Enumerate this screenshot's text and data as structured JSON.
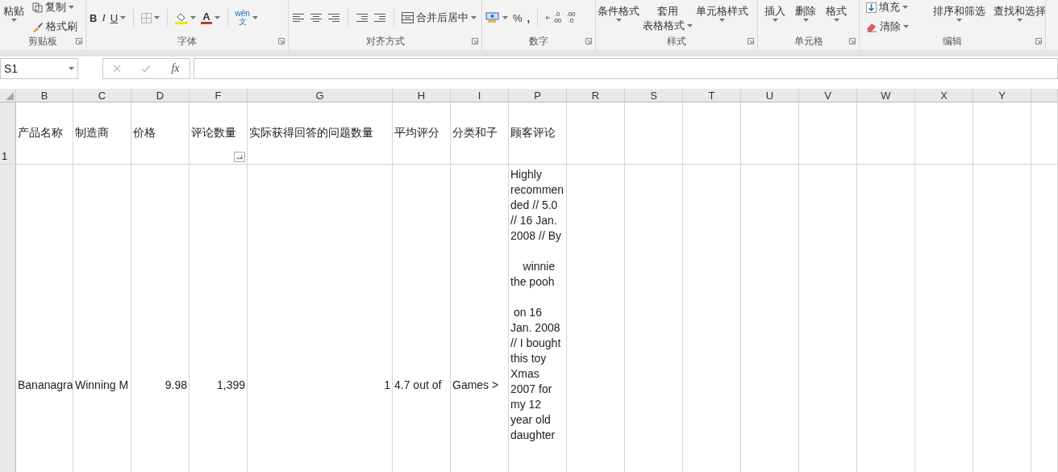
{
  "ribbon": {
    "clipboard": {
      "label": "剪贴板",
      "paste": "粘贴",
      "copy": "复制",
      "format_painter": "格式刷"
    },
    "font": {
      "label": "字体",
      "bold": "B",
      "italic": "I",
      "underline": "U",
      "font_color": "A",
      "phonetic_top": "wén",
      "phonetic_bottom": "文"
    },
    "alignment": {
      "label": "对齐方式",
      "merge": "合并后居中"
    },
    "number": {
      "label": "数字",
      "percent": "%",
      "comma": ",",
      "increase_decimal": {
        "top": ".0",
        "bottom": ".00"
      },
      "decrease_decimal": {
        "top": ".00",
        "bottom": ".0"
      }
    },
    "styles": {
      "label": "样式",
      "conditional": "条件格式",
      "table_format_top": "套用",
      "table_format_bottom": "表格格式",
      "cell_styles": "单元格样式"
    },
    "cells": {
      "label": "单元格",
      "insert": "插入",
      "delete": "删除",
      "format": "格式"
    },
    "editing": {
      "label": "编辑",
      "fill": "填充",
      "clear": "清除",
      "sort": "排序和筛选",
      "find": "查找和选择"
    }
  },
  "formula_bar": {
    "name_box": "S1",
    "fx": "fx"
  },
  "sheet": {
    "columns": [
      "B",
      "C",
      "D",
      "F",
      "G",
      "H",
      "I",
      "P",
      "R",
      "S",
      "T",
      "U",
      "V",
      "W",
      "X",
      "Y"
    ],
    "rows": [
      {
        "number": "1",
        "cells": [
          {
            "text": "产品名称",
            "kind": "text",
            "options_button": false
          },
          {
            "text": "制造商",
            "kind": "text",
            "options_button": false
          },
          {
            "text": "价格",
            "kind": "text",
            "options_button": false
          },
          {
            "text": "评论数量",
            "kind": "text",
            "options_button": true
          },
          {
            "text": "实际获得回答的问题数量",
            "kind": "text",
            "options_button": false
          },
          {
            "text": "平均评分",
            "kind": "text",
            "options_button": false
          },
          {
            "text": "分类和子",
            "kind": "text",
            "options_button": false
          },
          {
            "text": "顾客评论",
            "kind": "text",
            "options_button": false
          }
        ]
      },
      {
        "cells": [
          {
            "text": "Bananagra",
            "kind": "text",
            "options_button": false
          },
          {
            "text": "Winning M",
            "kind": "text",
            "options_button": false
          },
          {
            "text": "9.98",
            "kind": "number",
            "options_button": false
          },
          {
            "text": "1,399",
            "kind": "number",
            "options_button": false
          },
          {
            "text": "1",
            "kind": "number",
            "options_button": false
          },
          {
            "text": "4.7 out of",
            "kind": "text",
            "options_button": false
          },
          {
            "text": "Games >",
            "kind": "text",
            "options_button": false
          },
          {
            "text": "Highly recommended // 5.0 // 16 Jan. 2008 // By\n\n    winnie the pooh\n\n on 16 Jan. 2008 // I bought this toy Xmas 2007 for my 12 year old daughter",
            "kind": "wrap",
            "options_button": false
          }
        ]
      }
    ]
  }
}
